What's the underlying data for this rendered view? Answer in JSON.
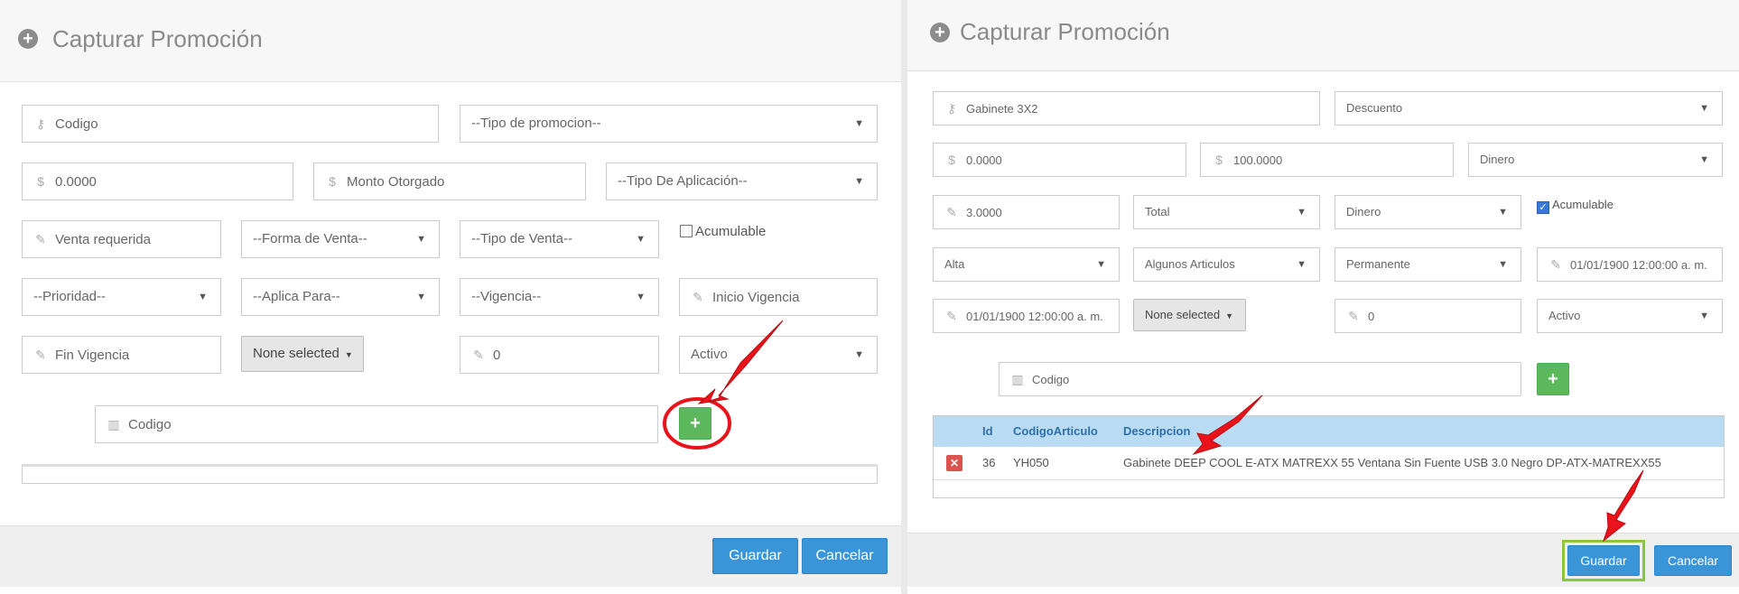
{
  "left_panel": {
    "title": "Capturar Promoción",
    "codigo_placeholder": "Codigo",
    "tipo_promocion": "--Tipo de promocion--",
    "monto_requerido": "0.0000",
    "monto_otorgado_placeholder": "Monto Otorgado",
    "tipo_aplicacion": "--Tipo De Aplicación--",
    "venta_requerida_placeholder": "Venta requerida",
    "forma_venta": "--Forma de Venta--",
    "tipo_venta": "--Tipo de Venta--",
    "acumulable_label": "Acumulable",
    "prioridad": "--Prioridad--",
    "aplica_para": "--Aplica Para--",
    "vigencia": "--Vigencia--",
    "inicio_vigencia_placeholder": "Inicio Vigencia",
    "fin_vigencia_placeholder": "Fin Vigencia",
    "multiselect": "None selected",
    "cantidad": "0",
    "estado": "Activo",
    "codigo_articulo_placeholder": "Codigo",
    "add_symbol": "+",
    "guardar": "Guardar",
    "cancelar": "Cancelar"
  },
  "right_panel": {
    "title": "Capturar Promoción",
    "codigo": "Gabinete 3X2",
    "tipo_promocion": "Descuento",
    "monto_requerido": "0.0000",
    "monto_otorgado": "100.0000",
    "tipo_aplicacion": "Dinero",
    "venta_requerida": "3.0000",
    "forma_venta": "Total",
    "tipo_venta": "Dinero",
    "acumulable_label": "Acumulable",
    "acumulable_checked": true,
    "prioridad": "Alta",
    "aplica_para": "Algunos Articulos",
    "vigencia": "Permanente",
    "inicio_vigencia": "01/01/1900 12:00:00 a. m.",
    "fin_vigencia": "01/01/1900 12:00:00 a. m.",
    "multiselect": "None selected",
    "cantidad": "0",
    "estado": "Activo",
    "codigo_articulo_placeholder": "Codigo",
    "add_symbol": "+",
    "table": {
      "headers": [
        "Id",
        "CodigoArticulo",
        "Descripcion"
      ],
      "rows": [
        {
          "id": "36",
          "codigo": "YH050",
          "descripcion": "Gabinete DEEP COOL E-ATX MATREXX 55 Ventana Sin Fuente USB 3.0 Negro DP-ATX-MATREXX55"
        }
      ]
    },
    "guardar": "Guardar",
    "cancelar": "Cancelar"
  },
  "colors": {
    "primary_button": "#3a95d8",
    "add_button": "#5cb85c",
    "delete_button": "#d9534f",
    "table_header": "#b9dcf2",
    "annotation_red": "#e8131b",
    "highlight_green": "#8cc63f"
  },
  "icons": {
    "header": "plus-circle-icon",
    "codigo": "key-icon",
    "monto": "dollar-icon",
    "edit": "edit-icon",
    "barcode": "barcode-icon",
    "remove": "close-icon"
  }
}
